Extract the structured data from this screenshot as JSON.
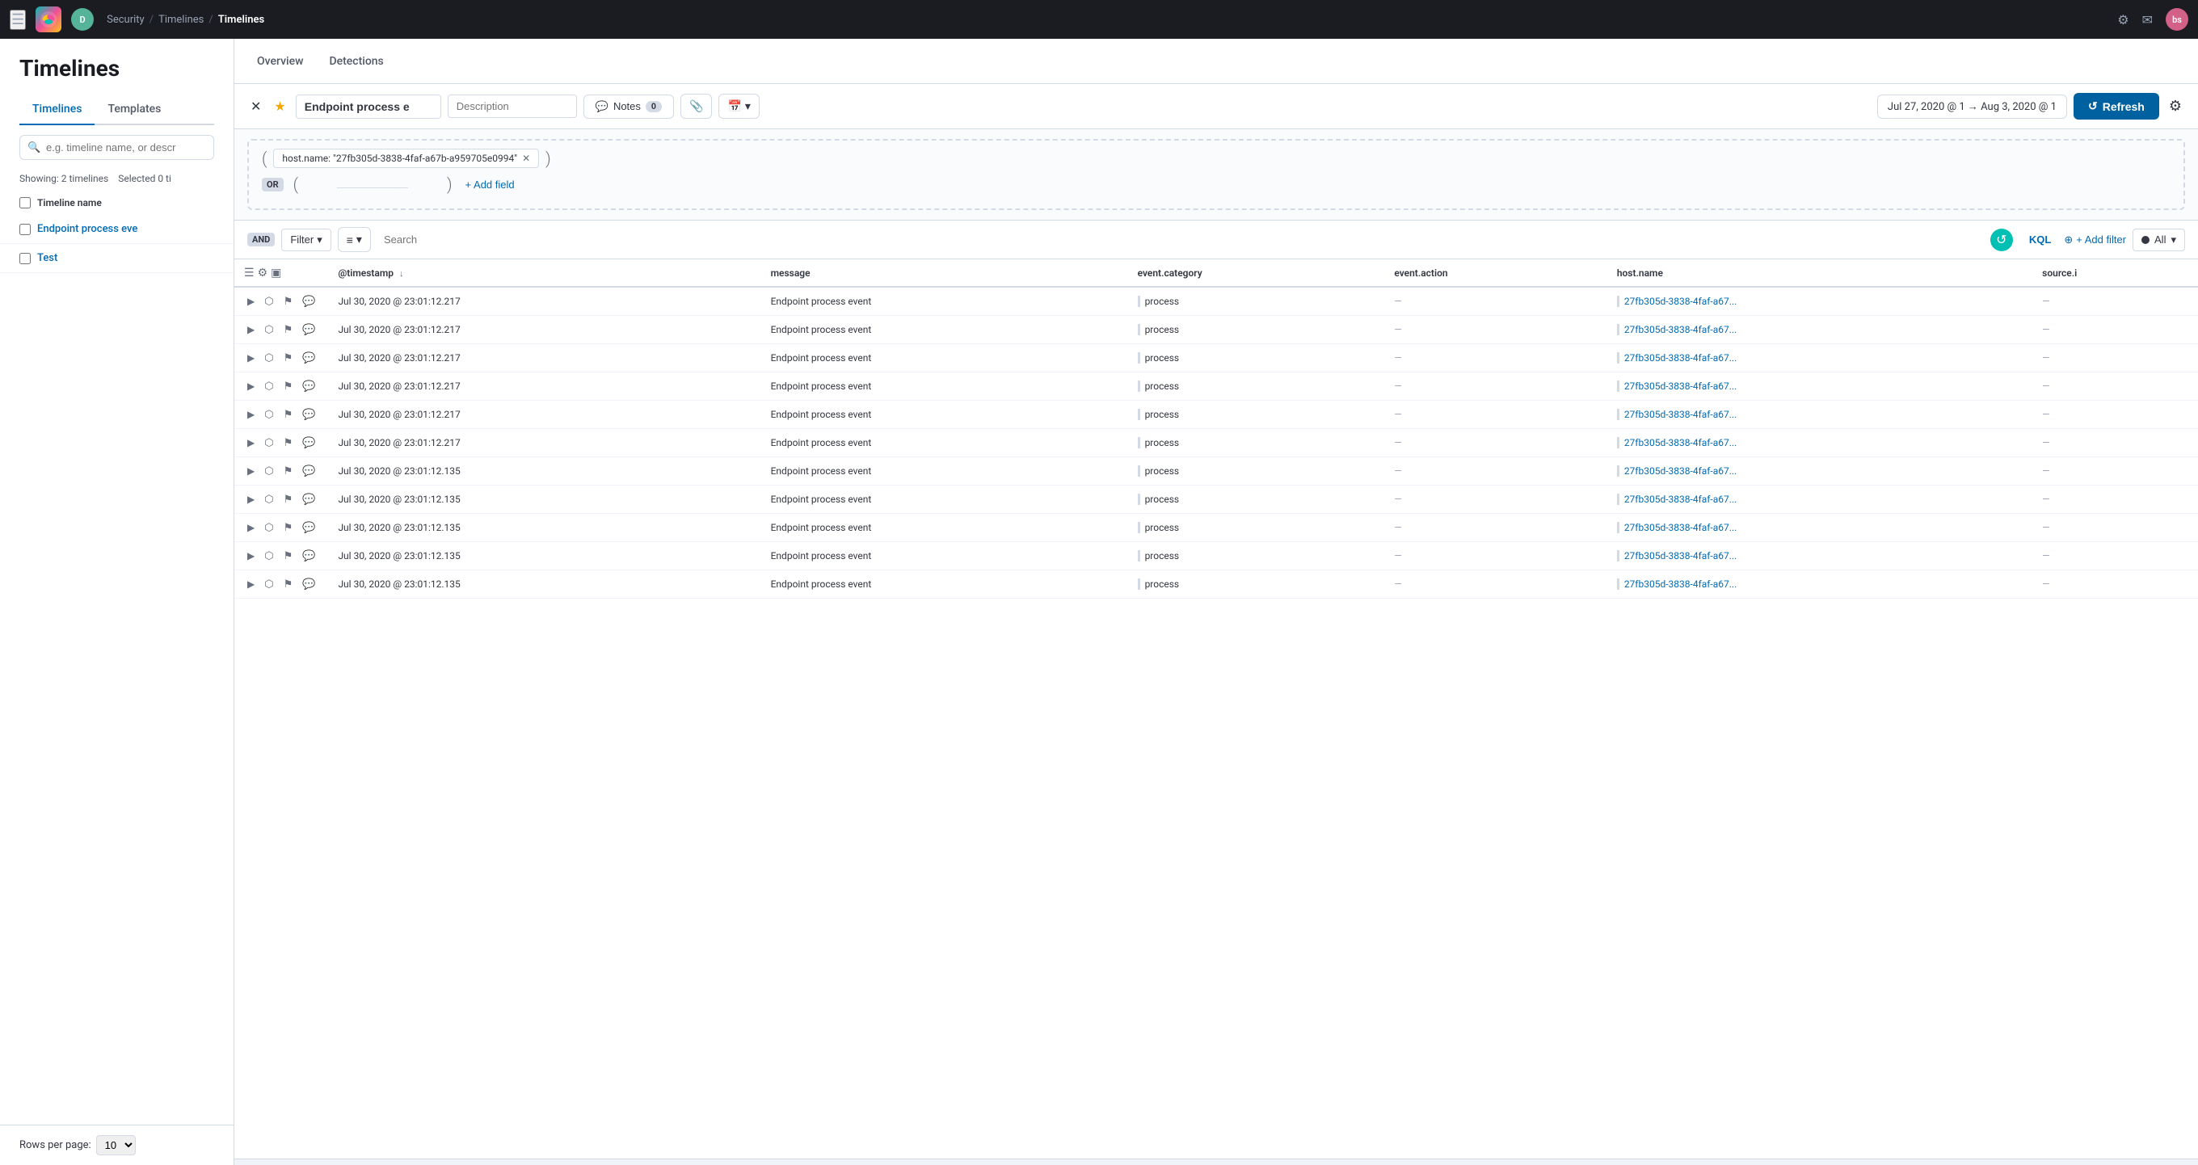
{
  "app": {
    "name": "Elastic Security"
  },
  "topnav": {
    "breadcrumbs": [
      "Security",
      "Timelines",
      "Timelines"
    ],
    "user_avatar": "bs",
    "user_badge": "D"
  },
  "sidebar": {
    "title": "Timelines",
    "tabs": [
      "Timelines",
      "Templates"
    ],
    "search_placeholder": "e.g. timeline name, or descr",
    "meta_showing": "Showing: 2 timelines",
    "meta_selected": "Selected 0 ti",
    "col_label": "Timeline name",
    "items": [
      {
        "name": "Endpoint process eve"
      },
      {
        "name": "Test"
      }
    ],
    "rows_per_page": "10"
  },
  "secondary_nav": {
    "items": [
      "Overview",
      "Detections"
    ]
  },
  "toolbar": {
    "timeline_name": "Endpoint process e",
    "description_placeholder": "Description",
    "notes_label": "Notes",
    "notes_count": "0",
    "date_range": "Jul 27, 2020 @ 1  →  Aug 3, 2020 @ 1",
    "refresh_label": "Refresh"
  },
  "query": {
    "filter_value": "host.name: \"27fb305d-3838-4faf-a67b-a959705e0994\"",
    "add_field_label": "+ Add field",
    "or_label": "OR"
  },
  "filter_bar": {
    "and_label": "AND",
    "filter_label": "Filter",
    "search_placeholder": "Search",
    "kql_label": "KQL",
    "all_label": "All",
    "add_filter_label": "+ Add filter"
  },
  "table": {
    "columns": [
      {
        "key": "actions",
        "label": ""
      },
      {
        "key": "timestamp",
        "label": "@timestamp",
        "sortable": true
      },
      {
        "key": "message",
        "label": "message"
      },
      {
        "key": "event_category",
        "label": "event.category"
      },
      {
        "key": "event_action",
        "label": "event.action"
      },
      {
        "key": "host_name",
        "label": "host.name"
      },
      {
        "key": "source_ip",
        "label": "source.i"
      }
    ],
    "rows": [
      {
        "timestamp": "Jul 30, 2020 @ 23:01:12.217",
        "message": "Endpoint process event",
        "event_category": "process",
        "event_action": "—",
        "host_name": "27fb305d-3838-4faf-a67...",
        "source_ip": "—"
      },
      {
        "timestamp": "Jul 30, 2020 @ 23:01:12.217",
        "message": "Endpoint process event",
        "event_category": "process",
        "event_action": "—",
        "host_name": "27fb305d-3838-4faf-a67...",
        "source_ip": "—"
      },
      {
        "timestamp": "Jul 30, 2020 @ 23:01:12.217",
        "message": "Endpoint process event",
        "event_category": "process",
        "event_action": "—",
        "host_name": "27fb305d-3838-4faf-a67...",
        "source_ip": "—"
      },
      {
        "timestamp": "Jul 30, 2020 @ 23:01:12.217",
        "message": "Endpoint process event",
        "event_category": "process",
        "event_action": "—",
        "host_name": "27fb305d-3838-4faf-a67...",
        "source_ip": "—"
      },
      {
        "timestamp": "Jul 30, 2020 @ 23:01:12.217",
        "message": "Endpoint process event",
        "event_category": "process",
        "event_action": "—",
        "host_name": "27fb305d-3838-4faf-a67...",
        "source_ip": "—"
      },
      {
        "timestamp": "Jul 30, 2020 @ 23:01:12.217",
        "message": "Endpoint process event",
        "event_category": "process",
        "event_action": "—",
        "host_name": "27fb305d-3838-4faf-a67...",
        "source_ip": "—"
      },
      {
        "timestamp": "Jul 30, 2020 @ 23:01:12.135",
        "message": "Endpoint process event",
        "event_category": "process",
        "event_action": "—",
        "host_name": "27fb305d-3838-4faf-a67...",
        "source_ip": "—"
      },
      {
        "timestamp": "Jul 30, 2020 @ 23:01:12.135",
        "message": "Endpoint process event",
        "event_category": "process",
        "event_action": "—",
        "host_name": "27fb305d-3838-4faf-a67...",
        "source_ip": "—"
      },
      {
        "timestamp": "Jul 30, 2020 @ 23:01:12.135",
        "message": "Endpoint process event",
        "event_category": "process",
        "event_action": "—",
        "host_name": "27fb305d-3838-4faf-a67...",
        "source_ip": "—"
      },
      {
        "timestamp": "Jul 30, 2020 @ 23:01:12.135",
        "message": "Endpoint process event",
        "event_category": "process",
        "event_action": "—",
        "host_name": "27fb305d-3838-4faf-a67...",
        "source_ip": "—"
      },
      {
        "timestamp": "Jul 30, 2020 @ 23:01:12.135",
        "message": "Endpoint process event",
        "event_category": "process",
        "event_action": "—",
        "host_name": "27fb305d-3838-4faf-a67...",
        "source_ip": "—"
      }
    ]
  }
}
